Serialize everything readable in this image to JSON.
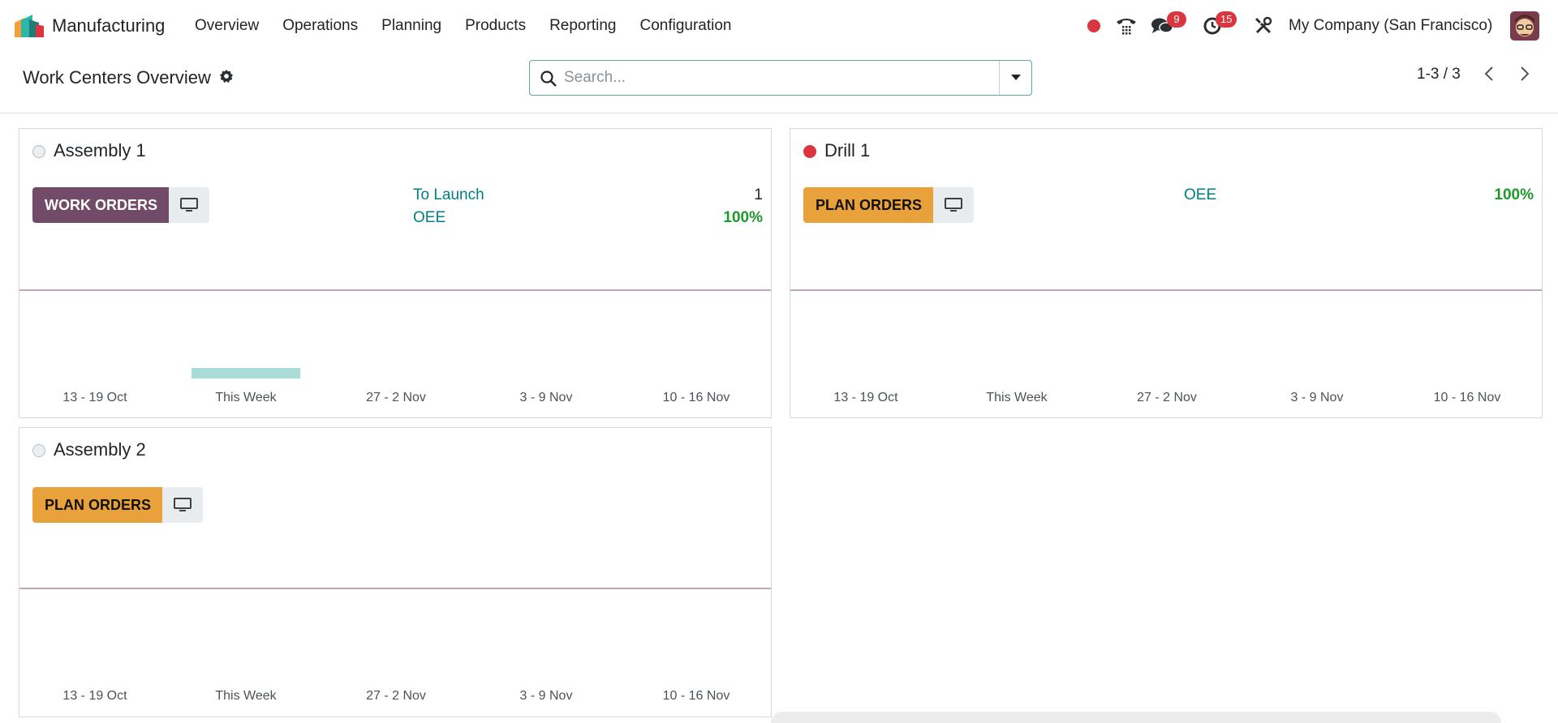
{
  "navbar": {
    "app_name": "Manufacturing",
    "menu": [
      "Overview",
      "Operations",
      "Planning",
      "Products",
      "Reporting",
      "Configuration"
    ],
    "messages_badge": "9",
    "activities_badge": "15",
    "company": "My Company (San Francisco)"
  },
  "control_panel": {
    "title": "Work Centers Overview",
    "search_placeholder": "Search...",
    "pager": "1-3 / 3"
  },
  "cards": [
    {
      "name": "Assembly 1",
      "status": "grey",
      "button": "WORK ORDERS",
      "stats": [
        {
          "label": "To Launch",
          "value": "1"
        },
        {
          "label": "OEE",
          "value": "100%"
        }
      ],
      "weeks": [
        "13 - 19 Oct",
        "This Week",
        "27 - 2 Nov",
        "3 - 9 Nov",
        "10 - 16 Nov"
      ]
    },
    {
      "name": "Drill 1",
      "status": "red",
      "button": "PLAN ORDERS",
      "stats": [
        {
          "label": "OEE",
          "value": "100%"
        }
      ],
      "weeks": [
        "13 - 19 Oct",
        "This Week",
        "27 - 2 Nov",
        "3 - 9 Nov",
        "10 - 16 Nov"
      ]
    },
    {
      "name": "Assembly 2",
      "status": "grey",
      "button": "PLAN ORDERS",
      "stats": [],
      "weeks": [
        "13 - 19 Oct",
        "This Week",
        "27 - 2 Nov",
        "3 - 9 Nov",
        "10 - 16 Nov"
      ]
    }
  ],
  "colors": {
    "brand": "#714b67",
    "accent_teal": "#017e84",
    "plan_orange": "#e9a23b",
    "status_red": "#d9363e",
    "success_green": "#1c9b2c"
  },
  "icons": {
    "logo": "manufacturing-logo-icon",
    "phone": "phone-icon",
    "messages": "chat-bubbles-icon",
    "activities": "clock-icon",
    "debug": "tools-icon",
    "settings": "gear-icon",
    "search": "search-icon",
    "workcenter_display": "monitor-icon"
  }
}
